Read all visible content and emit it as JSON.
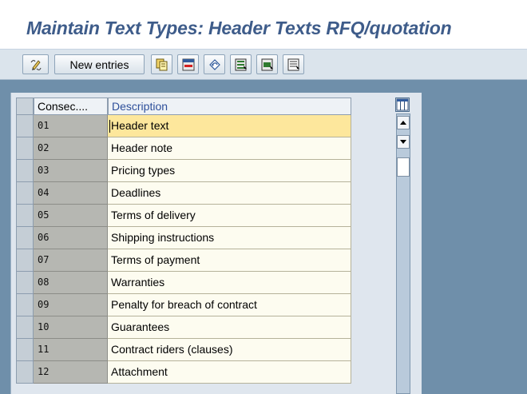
{
  "window": {
    "title": "Maintain Text Types: Header Texts RFQ/quotation"
  },
  "toolbar": {
    "new_entries_label": "New entries",
    "icons": [
      "pencil-display-change-icon",
      "copy-icon",
      "delete-icon",
      "undo-change-icon",
      "select-all-icon",
      "select-block-icon",
      "deselect-all-icon"
    ]
  },
  "table": {
    "columns": [
      "Consec....",
      "Description"
    ],
    "rows": [
      {
        "number": "01",
        "description": "Header text"
      },
      {
        "number": "02",
        "description": "Header note"
      },
      {
        "number": "03",
        "description": "Pricing types"
      },
      {
        "number": "04",
        "description": "Deadlines"
      },
      {
        "number": "05",
        "description": "Terms of delivery"
      },
      {
        "number": "06",
        "description": "Shipping instructions"
      },
      {
        "number": "07",
        "description": "Terms of payment"
      },
      {
        "number": "08",
        "description": "Warranties"
      },
      {
        "number": "09",
        "description": "Penalty for breach of contract"
      },
      {
        "number": "10",
        "description": "Guarantees"
      },
      {
        "number": "11",
        "description": "Contract riders (clauses)"
      },
      {
        "number": "12",
        "description": "Attachment"
      }
    ],
    "active_row": 1
  },
  "colors": {
    "title": "#3e5c8a",
    "background": "#6f8faa",
    "active_cell": "#fde79c",
    "input_cell": "#fdfcf0",
    "key_cell": "#b6b7b2"
  }
}
